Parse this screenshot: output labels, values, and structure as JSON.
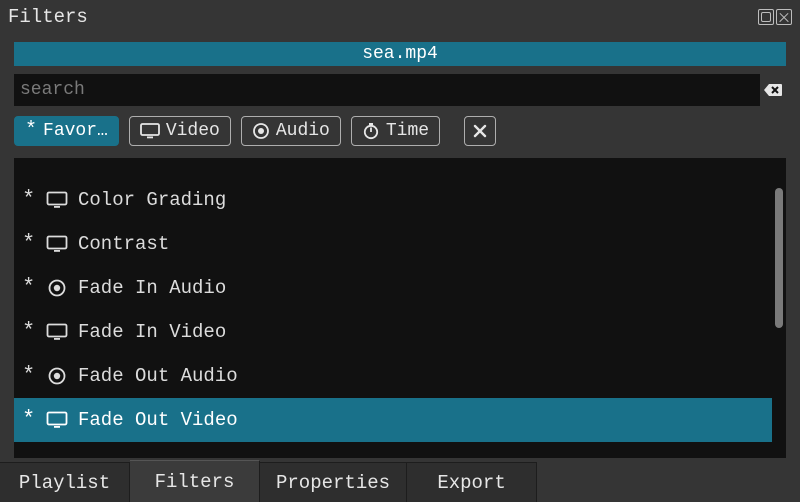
{
  "panel": {
    "title": "Filters"
  },
  "file": {
    "name": "sea.mp4"
  },
  "search": {
    "placeholder": "search",
    "value": ""
  },
  "categories": {
    "favorites": "Favor…",
    "video": "Video",
    "audio": "Audio",
    "time": "Time"
  },
  "filters": [
    {
      "label": "",
      "type": "video",
      "partial": true
    },
    {
      "label": "Color Grading",
      "type": "video"
    },
    {
      "label": "Contrast",
      "type": "video"
    },
    {
      "label": "Fade In Audio",
      "type": "audio"
    },
    {
      "label": "Fade In Video",
      "type": "video"
    },
    {
      "label": "Fade Out Audio",
      "type": "audio"
    },
    {
      "label": "Fade Out Video",
      "type": "video",
      "selected": true
    }
  ],
  "tabs": {
    "playlist": "Playlist",
    "filters": "Filters",
    "properties": "Properties",
    "export": "Export"
  },
  "colors": {
    "accent": "#19718a",
    "bg": "#353535",
    "listbg": "#111111"
  }
}
